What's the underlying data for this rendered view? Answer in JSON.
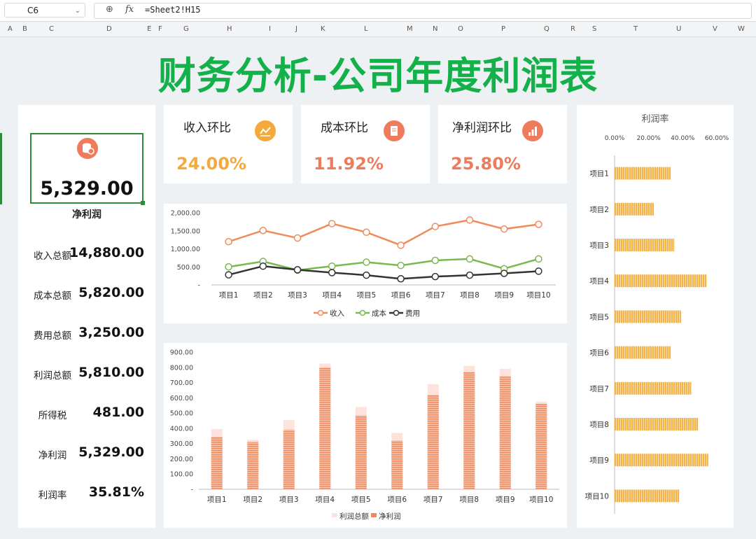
{
  "formula_bar": {
    "cell_ref": "C6",
    "formula": "=Sheet2!H15",
    "fx_label": "fx"
  },
  "columns": [
    "A",
    "B",
    "C",
    "D",
    "E",
    "F",
    "G",
    "H",
    "I",
    "J",
    "K",
    "L",
    "M",
    "N",
    "O",
    "P",
    "Q",
    "R",
    "S",
    "T",
    "U",
    "V",
    "W"
  ],
  "title": "财务分析-公司年度利润表",
  "net_profit_card": {
    "value": "5,329.00",
    "label": "净利润"
  },
  "metrics": [
    {
      "label": "收入总额",
      "value": "14,880.00"
    },
    {
      "label": "成本总额",
      "value": "5,820.00"
    },
    {
      "label": "费用总额",
      "value": "3,250.00"
    },
    {
      "label": "利润总额",
      "value": "5,810.00"
    },
    {
      "label": "所得税",
      "value": "481.00"
    },
    {
      "label": "净利润",
      "value": "5,329.00"
    },
    {
      "label": "利润率",
      "value": "35.81%"
    }
  ],
  "kpis": [
    {
      "title": "收入环比",
      "value": "24.00%",
      "color": "#f4a93b",
      "icon": "line-chart-icon"
    },
    {
      "title": "成本环比",
      "value": "11.92%",
      "color": "#ef7b5d",
      "icon": "document-icon"
    },
    {
      "title": "净利润环比",
      "value": "25.80%",
      "color": "#ef7b5d",
      "icon": "bar-chart-icon"
    }
  ],
  "colors": {
    "title_green": "#14b14a",
    "income": "#f08a58",
    "cost": "#79b94f",
    "expense": "#333333",
    "net_bar": "#ee8a5e",
    "total_bar": "#fde3dc",
    "rate_bar": "#f2b44a",
    "card_icon": "#ef7b5d"
  },
  "chart_data": [
    {
      "type": "line",
      "title": "",
      "categories": [
        "项目1",
        "项目2",
        "项目3",
        "项目4",
        "项目5",
        "项目6",
        "项目7",
        "项目8",
        "项目9",
        "项目10"
      ],
      "series": [
        {
          "name": "收入",
          "values": [
            1200,
            1510,
            1300,
            1700,
            1460,
            1100,
            1620,
            1800,
            1550,
            1680
          ]
        },
        {
          "name": "成本",
          "values": [
            500,
            650,
            410,
            520,
            630,
            540,
            680,
            720,
            450,
            720
          ]
        },
        {
          "name": "费用",
          "values": [
            280,
            520,
            420,
            340,
            270,
            170,
            230,
            270,
            320,
            380
          ]
        }
      ],
      "y_ticks": [
        "2,000.00",
        "1,500.00",
        "1,000.00",
        "500.00",
        "-"
      ],
      "ylim": [
        0,
        2000
      ],
      "legend": "bottom"
    },
    {
      "type": "bar",
      "title": "",
      "categories": [
        "项目1",
        "项目2",
        "项目3",
        "项目4",
        "项目5",
        "项目6",
        "项目7",
        "项目8",
        "项目9",
        "项目10"
      ],
      "series": [
        {
          "name": "利润总额",
          "values": [
            395,
            325,
            455,
            825,
            540,
            370,
            690,
            810,
            790,
            575
          ]
        },
        {
          "name": "净利润",
          "values": [
            345,
            310,
            390,
            800,
            485,
            320,
            620,
            770,
            740,
            560
          ]
        }
      ],
      "y_ticks": [
        "900.00",
        "800.00",
        "700.00",
        "600.00",
        "500.00",
        "400.00",
        "300.00",
        "200.00",
        "100.00",
        "-"
      ],
      "ylim": [
        0,
        900
      ],
      "legend": "bottom"
    },
    {
      "type": "bar",
      "orientation": "horizontal",
      "title": "利润率",
      "categories": [
        "项目1",
        "项目2",
        "项目3",
        "项目4",
        "项目5",
        "项目6",
        "项目7",
        "项目8",
        "项目9",
        "项目10"
      ],
      "values": [
        0.33,
        0.23,
        0.35,
        0.54,
        0.39,
        0.33,
        0.45,
        0.49,
        0.55,
        0.38
      ],
      "x_ticks": [
        "0.00%",
        "20.00%",
        "40.00%",
        "60.00%"
      ],
      "xlim": [
        0,
        0.6
      ]
    }
  ]
}
